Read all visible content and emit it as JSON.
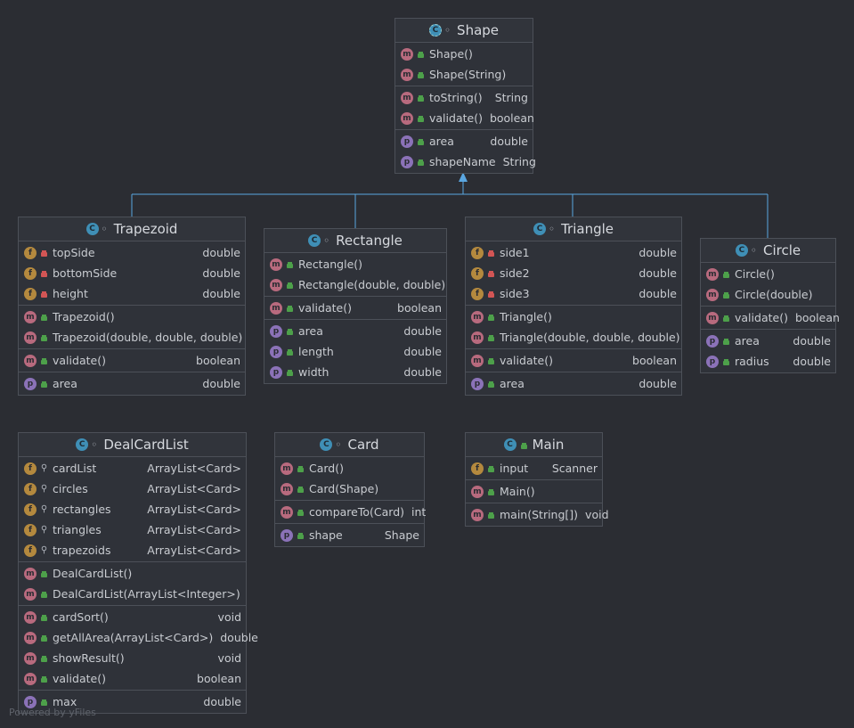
{
  "classes": {
    "shape": {
      "title": "Shape",
      "kind": "abstract-class",
      "constructors": [
        {
          "name": "Shape()",
          "type": ""
        },
        {
          "name": "Shape(String)",
          "type": ""
        }
      ],
      "methods": [
        {
          "name": "toString()",
          "type": "String"
        },
        {
          "name": "validate()",
          "type": "boolean"
        }
      ],
      "properties": [
        {
          "name": "area",
          "type": "double"
        },
        {
          "name": "shapeName",
          "type": "String"
        }
      ]
    },
    "trapezoid": {
      "title": "Trapezoid",
      "fields": [
        {
          "name": "topSide",
          "type": "double"
        },
        {
          "name": "bottomSide",
          "type": "double"
        },
        {
          "name": "height",
          "type": "double"
        }
      ],
      "constructors": [
        {
          "name": "Trapezoid()",
          "type": ""
        },
        {
          "name": "Trapezoid(double, double, double)",
          "type": ""
        }
      ],
      "methods": [
        {
          "name": "validate()",
          "type": "boolean"
        }
      ],
      "properties": [
        {
          "name": "area",
          "type": "double"
        }
      ]
    },
    "rectangle": {
      "title": "Rectangle",
      "constructors": [
        {
          "name": "Rectangle()",
          "type": ""
        },
        {
          "name": "Rectangle(double, double)",
          "type": ""
        }
      ],
      "methods": [
        {
          "name": "validate()",
          "type": "boolean"
        }
      ],
      "properties": [
        {
          "name": "area",
          "type": "double"
        },
        {
          "name": "length",
          "type": "double"
        },
        {
          "name": "width",
          "type": "double"
        }
      ]
    },
    "triangle": {
      "title": "Triangle",
      "fields": [
        {
          "name": "side1",
          "type": "double"
        },
        {
          "name": "side2",
          "type": "double"
        },
        {
          "name": "side3",
          "type": "double"
        }
      ],
      "constructors": [
        {
          "name": "Triangle()",
          "type": ""
        },
        {
          "name": "Triangle(double, double, double)",
          "type": ""
        }
      ],
      "methods": [
        {
          "name": "validate()",
          "type": "boolean"
        }
      ],
      "properties": [
        {
          "name": "area",
          "type": "double"
        }
      ]
    },
    "circle": {
      "title": "Circle",
      "constructors": [
        {
          "name": "Circle()",
          "type": ""
        },
        {
          "name": "Circle(double)",
          "type": ""
        }
      ],
      "methods": [
        {
          "name": "validate()",
          "type": "boolean"
        }
      ],
      "properties": [
        {
          "name": "area",
          "type": "double"
        },
        {
          "name": "radius",
          "type": "double"
        }
      ]
    },
    "dealcardlist": {
      "title": "DealCardList",
      "fields": [
        {
          "name": "cardList",
          "type": "ArrayList<Card>"
        },
        {
          "name": "circles",
          "type": "ArrayList<Card>"
        },
        {
          "name": "rectangles",
          "type": "ArrayList<Card>"
        },
        {
          "name": "triangles",
          "type": "ArrayList<Card>"
        },
        {
          "name": "trapezoids",
          "type": "ArrayList<Card>"
        }
      ],
      "constructors": [
        {
          "name": "DealCardList()",
          "type": ""
        },
        {
          "name": "DealCardList(ArrayList<Integer>)",
          "type": ""
        }
      ],
      "methods": [
        {
          "name": "cardSort()",
          "type": "void"
        },
        {
          "name": "getAllArea(ArrayList<Card>)",
          "type": "double"
        },
        {
          "name": "showResult()",
          "type": "void"
        },
        {
          "name": "validate()",
          "type": "boolean"
        }
      ],
      "properties": [
        {
          "name": "max",
          "type": "double"
        }
      ]
    },
    "card": {
      "title": "Card",
      "constructors": [
        {
          "name": "Card()",
          "type": ""
        },
        {
          "name": "Card(Shape)",
          "type": ""
        }
      ],
      "methods": [
        {
          "name": "compareTo(Card)",
          "type": "int"
        }
      ],
      "properties": [
        {
          "name": "shape",
          "type": "Shape"
        }
      ]
    },
    "main": {
      "title": "Main",
      "fields": [
        {
          "name": "input",
          "type": "Scanner"
        }
      ],
      "constructors": [
        {
          "name": "Main()",
          "type": ""
        }
      ],
      "methods": [
        {
          "name": "main(String[])",
          "type": "void"
        }
      ]
    }
  },
  "watermark": "Powered by yFiles",
  "colors": {
    "background": "#2b2d33",
    "edge": "#5aa6e0",
    "method_badge": "#b86a7e",
    "field_badge": "#b4893e",
    "property_badge": "#8b72b8",
    "class_badge": "#3f8fb6"
  }
}
